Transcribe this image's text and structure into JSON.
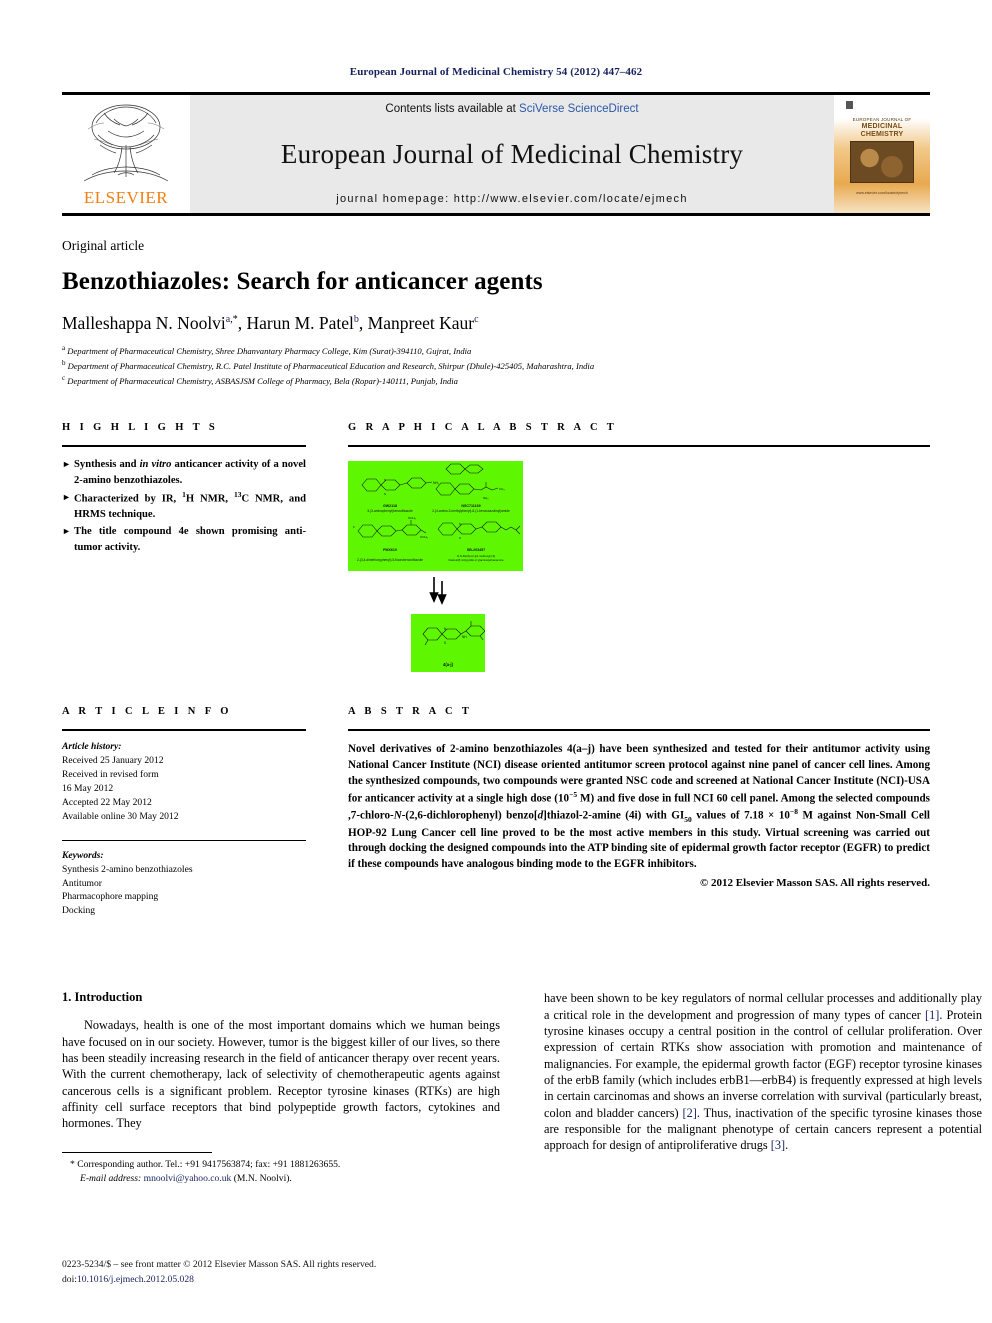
{
  "running_head": "European Journal of Medicinal Chemistry 54 (2012) 447–462",
  "masthead": {
    "publisher": "ELSEVIER",
    "contents_prefix": "Contents lists available at ",
    "contents_link": "SciVerse ScienceDirect",
    "journal_title": "European Journal of Medicinal Chemistry",
    "homepage": "journal homepage: http://www.elsevier.com/locate/ejmech",
    "cover": {
      "line1": "EUROPEAN JOURNAL OF",
      "line2": "MEDICINAL",
      "line3": "CHEMISTRY",
      "footer": "www.elsevier.com/locate/ejmech"
    }
  },
  "article": {
    "kicker": "Original article",
    "title": "Benzothiazoles: Search for anticancer agents",
    "authors": [
      {
        "name": "Malleshappa N. Noolvi",
        "sup": "a",
        "star": true
      },
      {
        "name": "Harun M. Patel",
        "sup": "b",
        "star": false
      },
      {
        "name": "Manpreet Kaur",
        "sup": "c",
        "star": false
      }
    ],
    "affiliations": [
      {
        "sup": "a",
        "text": "Department of Pharmaceutical Chemistry, Shree Dhanvantary Pharmacy College, Kim (Surat)-394110, Gujrat, India"
      },
      {
        "sup": "b",
        "text": "Department of Pharmaceutical Chemistry, R.C. Patel Institute of Pharmaceutical Education and Research, Shirpur (Dhule)-425405, Maharashtra, India"
      },
      {
        "sup": "c",
        "text": "Department of Pharmaceutical Chemistry, ASBASJSM College of Pharmacy, Bela (Ropar)-140111, Punjab, India"
      }
    ]
  },
  "highlights": {
    "heading": "H I G H L I G H T S",
    "items": [
      "Synthesis and <i>in vitro</i> anticancer activity of a novel 2-amino benzothiazoles.",
      "Characterized by IR, <sup>1</sup>H NMR, <sup>13</sup>C NMR, and HRMS technique.",
      "The title compound 4e shown promising anti-tumor activity."
    ],
    "bullet": "triangle-right-icon"
  },
  "graphical_abstract": {
    "heading": "G R A P H I C A L   A B S T R A C T",
    "box_color": "#5ef600",
    "top_box": {
      "molecules": [
        {
          "code": "GW2118",
          "caption": "3-(3-aminophenyl)benzothiazole"
        },
        {
          "code": "NSC711169",
          "caption": "2-(4-amino-3-methylphenyl)-6-(1-benzoxazolinyl)amide"
        },
        {
          "code": "PMX610",
          "caption": "2-(3,4-dimethoxyphenyl)-5-fluorobenzothiazole"
        },
        {
          "code": "SB-203457",
          "caption": "N,N-Diethyl-2-[(4-methoxy[1,3]thiazolo[5,4-b]pyridin-2-yl)amino]ethanamine"
        }
      ]
    },
    "arrow": "double-down-arrow-icon",
    "bottom_box": {
      "code": "4(a-j)"
    }
  },
  "article_info": {
    "heading": "A R T I C L E   I N F O",
    "history_label": "Article history:",
    "history": [
      "Received 25 January 2012",
      "Received in revised form",
      "16 May 2012",
      "Accepted 22 May 2012",
      "Available online 30 May 2012"
    ],
    "keywords_label": "Keywords:",
    "keywords": [
      "Synthesis 2-amino benzothiazoles",
      "Antitumor",
      "Pharmacophore mapping",
      "Docking"
    ]
  },
  "abstract": {
    "heading": "A B S T R A C T",
    "text": "Novel derivatives of 2-amino benzothiazoles 4(a&ndash;j) have been synthesized and tested for their antitumor activity using National Cancer Institute (NCI) disease oriented antitumor screen protocol against nine panel of cancer cell lines. Among the synthesized compounds, two compounds were granted NSC code and screened at National Cancer Institute (NCI)-USA for anticancer activity at a single high dose (10<sup>&minus;5</sup> M) and five dose in full NCI 60 cell panel. Among the selected compounds ,7-chloro-<i>N</i>-(2,6-dichlorophenyl) benzo[<i>d</i>]thiazol-2-amine (4i) with GI<sub>50</sub> values of 7.18 &times; 10<sup>&minus;8</sup> M against Non-Small Cell HOP-92 Lung Cancer cell line proved to be the most active members in this study. Virtual screening was carried out through docking the designed compounds into the ATP binding site of epidermal growth factor receptor (EGFR) to predict if these compounds have analogous binding mode to the EGFR inhibitors.",
    "copyright": "© 2012 Elsevier Masson SAS. All rights reserved."
  },
  "body": {
    "section_number_title": "1.  Introduction",
    "left_paragraphs": [
      "Nowadays, health is one of the most important domains which we human beings have focused on in our society. However, tumor is the biggest killer of our lives, so there has been steadily increasing research in the field of anticancer therapy over recent years. With the current chemotherapy, lack of selectivity of chemotherapeutic agents against cancerous cells is a significant problem. Receptor tyrosine kinases (RTKs) are high affinity cell surface receptors that bind polypeptide growth factors, cytokines and hormones. They"
    ],
    "right_paragraphs": [
      "have been shown to be key regulators of normal cellular processes and additionally play a critical role in the development and progression of many types of cancer <span class=\"ref\">[1]</span>. Protein tyrosine kinases occupy a central position in the control of cellular proliferation. Over expression of certain RTKs show association with promotion and maintenance of malignancies. For example, the epidermal growth factor (EGF) receptor tyrosine kinases of the erbB family (which includes erbB1&mdash;erbB4) is frequently expressed at high levels in certain carcinomas and shows an inverse correlation with survival (particularly breast, colon and bladder cancers) <span class=\"ref\">[2]</span>. Thus, inactivation of the specific tyrosine kinases those are responsible for the malignant phenotype of certain cancers represent a potential approach for design of antiproliferative drugs <span class=\"ref\">[3]</span>."
    ]
  },
  "footnote": {
    "corresponding": "* Corresponding author. Tel.: +91 9417563874; fax: +91 1881263655.",
    "email_label": "E-mail address:",
    "email": "mnoolvi@yahoo.co.uk",
    "email_owner": "(M.N. Noolvi)."
  },
  "footer": {
    "line1": "0223-5234/$ – see front matter © 2012 Elsevier Masson SAS. All rights reserved.",
    "line2_prefix": "doi:",
    "line2_doi": "10.1016/j.ejmech.2012.05.028"
  }
}
